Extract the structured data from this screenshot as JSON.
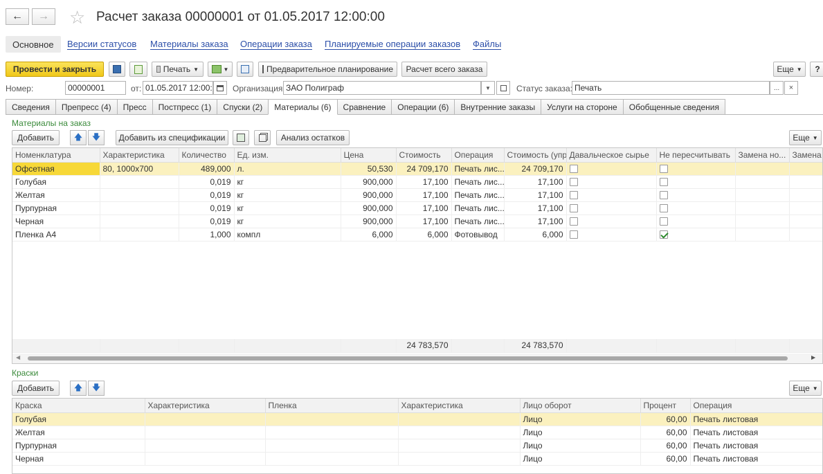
{
  "window": {
    "title": "Расчет заказа 00000001 от 01.05.2017 12:00:00"
  },
  "section_tabs": [
    "Основное",
    "Версии статусов",
    "Материалы заказа",
    "Операции заказа",
    "Планируемые операции заказов",
    "Файлы"
  ],
  "toolbar": {
    "post_close": "Провести и закрыть",
    "print": "Печать",
    "preliminary": "Предварительное планирование",
    "calc_all": "Расчет всего заказа",
    "more": "Еще",
    "help": "?"
  },
  "header": {
    "number_label": "Номер:",
    "number_value": "00000001",
    "date_label": "от:",
    "date_value": "01.05.2017 12:00:0",
    "org_label": "Организация:",
    "org_value": "ЗАО Полиграф",
    "status_label": "Статус заказа:",
    "status_value": "Печать"
  },
  "tabs": [
    "Сведения",
    "Препресс (4)",
    "Пресс",
    "Постпресс (1)",
    "Спуски (2)",
    "Материалы (6)",
    "Сравнение",
    "Операции (6)",
    "Внутренние заказы",
    "Услуги на стороне",
    "Обобщенные сведения"
  ],
  "materials": {
    "group_title": "Материалы на заказ",
    "add": "Добавить",
    "add_spec": "Добавить из спецификации",
    "analysis": "Анализ остатков",
    "more": "Еще",
    "columns": [
      "Номенклатура",
      "Характеристика",
      "Количество",
      "Ед. изм.",
      "Цена",
      "Стоимость",
      "Операция",
      "Стоимость (упр)",
      "Давальческое сырье",
      "Не пересчитывать",
      "Замена но...",
      "Замена х"
    ],
    "rows": [
      {
        "name": "Офсетная",
        "char": "80, 1000х700",
        "qty": "489,000",
        "unit": "л.",
        "price": "50,530",
        "cost": "24 709,170",
        "op": "Печать лис...",
        "cost_m": "24 709,170",
        "tolling": false,
        "norecalc": false
      },
      {
        "name": "Голубая",
        "char": "",
        "qty": "0,019",
        "unit": "кг",
        "price": "900,000",
        "cost": "17,100",
        "op": "Печать лис...",
        "cost_m": "17,100",
        "tolling": false,
        "norecalc": false
      },
      {
        "name": "Желтая",
        "char": "",
        "qty": "0,019",
        "unit": "кг",
        "price": "900,000",
        "cost": "17,100",
        "op": "Печать лис...",
        "cost_m": "17,100",
        "tolling": false,
        "norecalc": false
      },
      {
        "name": "Пурпурная",
        "char": "",
        "qty": "0,019",
        "unit": "кг",
        "price": "900,000",
        "cost": "17,100",
        "op": "Печать лис...",
        "cost_m": "17,100",
        "tolling": false,
        "norecalc": false
      },
      {
        "name": "Черная",
        "char": "",
        "qty": "0,019",
        "unit": "кг",
        "price": "900,000",
        "cost": "17,100",
        "op": "Печать лис...",
        "cost_m": "17,100",
        "tolling": false,
        "norecalc": false
      },
      {
        "name": "Пленка А4",
        "char": "",
        "qty": "1,000",
        "unit": "компл",
        "price": "6,000",
        "cost": "6,000",
        "op": "Фотовывод",
        "cost_m": "6,000",
        "tolling": false,
        "norecalc": true
      }
    ],
    "total_cost": "24 783,570",
    "total_cost_m": "24 783,570"
  },
  "inks": {
    "group_title": "Краски",
    "add": "Добавить",
    "more": "Еще",
    "columns": [
      "Краска",
      "Характеристика",
      "Пленка",
      "Характеристика",
      "Лицо оборот",
      "Процент",
      "Операция"
    ],
    "rows": [
      {
        "ink": "Голубая",
        "side": "Лицо",
        "pct": "60,00",
        "op": "Печать листовая"
      },
      {
        "ink": "Желтая",
        "side": "Лицо",
        "pct": "60,00",
        "op": "Печать листовая"
      },
      {
        "ink": "Пурпурная",
        "side": "Лицо",
        "pct": "60,00",
        "op": "Печать листовая"
      },
      {
        "ink": "Черная",
        "side": "Лицо",
        "pct": "60,00",
        "op": "Печать листовая"
      }
    ]
  }
}
